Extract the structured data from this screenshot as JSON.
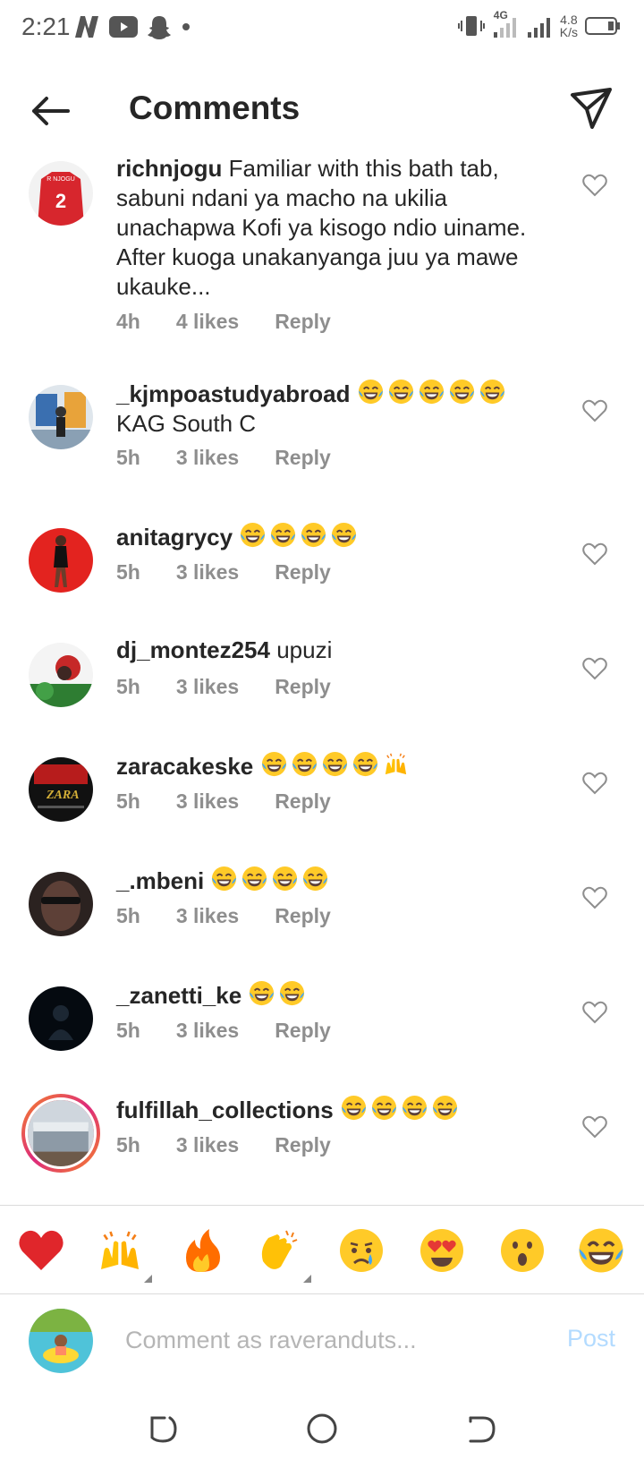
{
  "status_bar": {
    "time": "2:21",
    "net_type": "4G",
    "speed_value": "4.8",
    "speed_unit": "K/s"
  },
  "header": {
    "title": "Comments"
  },
  "comments": [
    {
      "username": "richnjogu",
      "text": "Familiar with this bath tab, sabuni ndani ya macho na ukilia unachapwa Kofi ya kisogo ndio uiname. After kuoga unakanyanga juu ya mawe ukauke...",
      "time": "4h",
      "likes": "4 likes",
      "reply": "Reply",
      "avatar_number": "2",
      "avatar_caption": "R NJOGU"
    },
    {
      "username": "_kjmpoastudyabroad",
      "text_line2": "KAG South C",
      "emoji_count": 5,
      "time": "5h",
      "likes": "3 likes",
      "reply": "Reply"
    },
    {
      "username": "anitagrycy",
      "emoji_count": 4,
      "time": "5h",
      "likes": "3 likes",
      "reply": "Reply"
    },
    {
      "username": "dj_montez254",
      "text": "upuzi",
      "time": "5h",
      "likes": "3 likes",
      "reply": "Reply"
    },
    {
      "username": "zaracakeske",
      "emoji_count": 4,
      "time": "5h",
      "likes": "3 likes",
      "reply": "Reply",
      "avatar_caption": "ZARA"
    },
    {
      "username": "_.mbeni",
      "emoji_count": 4,
      "time": "5h",
      "likes": "3 likes",
      "reply": "Reply"
    },
    {
      "username": "_zanetti_ke",
      "emoji_count": 2,
      "time": "5h",
      "likes": "3 likes",
      "reply": "Reply"
    },
    {
      "username": "fulfillah_collections",
      "emoji_count": 4,
      "time": "5h",
      "likes": "3 likes",
      "reply": "Reply"
    }
  ],
  "reactions": [
    "red-heart",
    "raised-hands",
    "fire",
    "clapping-hands",
    "crying-face",
    "heart-eyes",
    "surprised-face",
    "tears-of-joy"
  ],
  "composer": {
    "placeholder": "Comment as raveranduts...",
    "post_label": "Post"
  },
  "colors": {
    "text": "#262626",
    "meta": "#8e8e8e",
    "post_disabled": "#b3dbff",
    "heart_red": "#e0262b"
  }
}
